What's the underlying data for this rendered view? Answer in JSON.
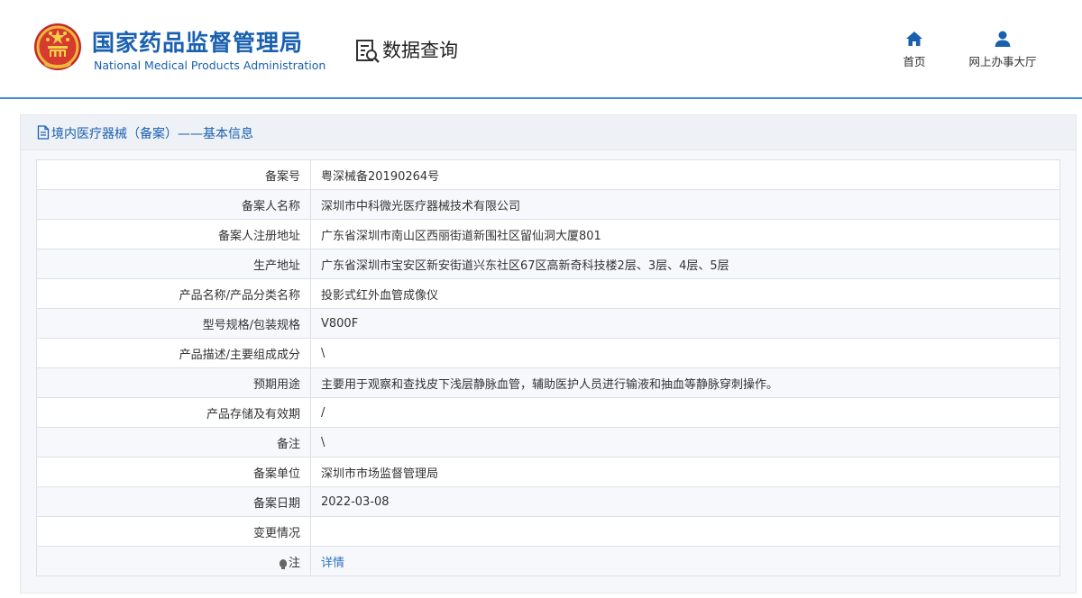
{
  "header": {
    "brand_cn": "国家药品监督管理局",
    "brand_en": "National Medical Products Administration",
    "page_title": "数据查询",
    "nav": [
      {
        "label": "首页",
        "icon": "home-icon"
      },
      {
        "label": "网上办事大厅",
        "icon": "user-icon"
      }
    ]
  },
  "panel": {
    "title": "境内医疗器械（备案）——基本信息"
  },
  "rows": [
    {
      "label": "备案号",
      "value": "粤深械备20190264号"
    },
    {
      "label": "备案人名称",
      "value": "深圳市中科微光医疗器械技术有限公司"
    },
    {
      "label": "备案人注册地址",
      "value": "广东省深圳市南山区西丽街道新围社区留仙洞大厦801"
    },
    {
      "label": "生产地址",
      "value": "广东省深圳市宝安区新安街道兴东社区67区高新奇科技楼2层、3层、4层、5层"
    },
    {
      "label": "产品名称/产品分类名称",
      "value": "投影式红外血管成像仪"
    },
    {
      "label": "型号规格/包装规格",
      "value": "V800F"
    },
    {
      "label": "产品描述/主要组成成分",
      "value": "\\"
    },
    {
      "label": "预期用途",
      "value": "主要用于观察和查找皮下浅层静脉血管，辅助医护人员进行输液和抽血等静脉穿刺操作。"
    },
    {
      "label": "产品存储及有效期",
      "value": "/"
    },
    {
      "label": "备注",
      "value": "\\"
    },
    {
      "label": "备案单位",
      "value": "深圳市市场监督管理局"
    },
    {
      "label": "备案日期",
      "value": "2022-03-08"
    },
    {
      "label": "变更情况",
      "value": ""
    },
    {
      "label": "注",
      "value": "详情"
    }
  ],
  "colors": {
    "brand_blue": "#1960b0",
    "header_line": "#3e8ed6",
    "link_blue": "#3072c6"
  }
}
